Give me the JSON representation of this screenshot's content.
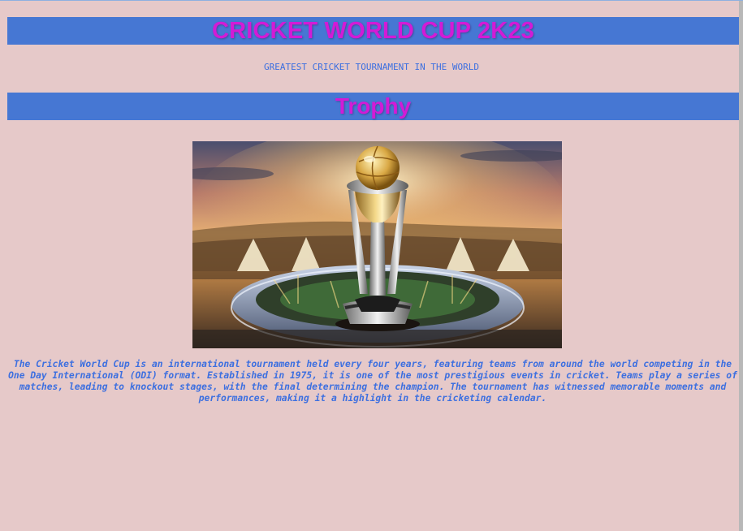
{
  "page": {
    "title": "CRICKET WORLD CUP 2K23",
    "subtitle": "GREATEST CRICKET TOURNAMENT IN THE WORLD",
    "section_heading": "Trophy",
    "description": "The Cricket World Cup is an international tournament held every four years, featuring teams from around the world competing in the One Day International (ODI) format. Established in 1975, it is one of the most prestigious events in cricket. Teams play a series of matches, leading to knockout stages, with the final determining the champion. The tournament has witnessed memorable moments and performances, making it a highlight in the cricketing calendar."
  },
  "colors": {
    "background": "#e6c9c9",
    "banner": "#4677d3",
    "heading_text": "#d21bd6",
    "body_text": "#3c6fe0"
  },
  "image": {
    "subject": "trophy-image"
  }
}
